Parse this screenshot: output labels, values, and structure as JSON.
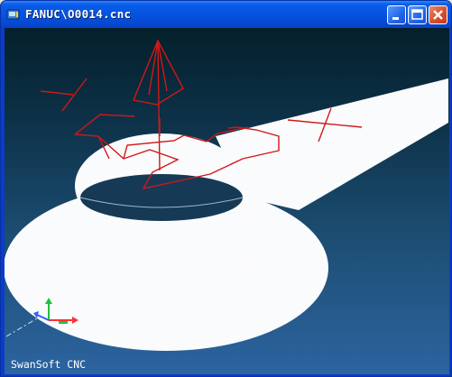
{
  "window": {
    "title": "FANUC\\O0014.cnc",
    "icon": "cnc-app-icon",
    "buttons": [
      "minimize",
      "maximize",
      "close"
    ]
  },
  "viewport": {
    "watermark": "SwanSoft CNC",
    "axis_gizmo_colors": {
      "x": "#ff3030",
      "y": "#20c040",
      "z": "#3060ff"
    },
    "toolpath_color": "#d01818",
    "workpiece_color": "#ffffff"
  }
}
